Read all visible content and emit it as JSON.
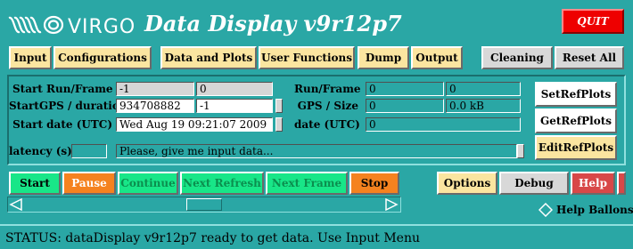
{
  "header": {
    "logo_text": "VIRGO",
    "title": "Data Display  v9r12p7",
    "quit_label": "QUIT"
  },
  "menu": {
    "input": "Input",
    "configurations": "Configurations",
    "data_and_plots": "Data and Plots",
    "user_functions": "User Functions",
    "dump": "Dump",
    "output": "Output",
    "cleaning": "Cleaning",
    "reset_all": "Reset All"
  },
  "panel": {
    "start_run_label": "Start Run/Frame",
    "start_run_value1": "-1",
    "start_run_value2": "0",
    "start_gps_label": "StartGPS / duration",
    "start_gps_value": "934708882",
    "duration_value": "-1",
    "start_date_label": "Start date (UTC)",
    "start_date_value": "Wed Aug 19 09:21:07 2009",
    "run_frame_label": "Run/Frame",
    "run_frame_value1": "0",
    "run_frame_value2": "0",
    "gps_size_label": "GPS  / Size",
    "gps_value": "0",
    "size_value": "0.0 kB",
    "date_label": "date (UTC)",
    "date_value": "0",
    "latency_label": "latency (s)",
    "message": "Please, give me input data..."
  },
  "ref_buttons": {
    "set": "SetRefPlots",
    "get": "GetRefPlots",
    "edit": "EditRefPlots"
  },
  "controls": {
    "start": "Start",
    "pause": "Pause",
    "continue": "Continue",
    "next_refresh": "Next Refresh",
    "next_frame": "Next Frame",
    "stop": "Stop",
    "options": "Options",
    "debug": "Debug",
    "help": "Help",
    "help_balloons": "Help Ballons"
  },
  "status": {
    "text": "STATUS: dataDisplay v9r12p7 ready to get data. Use Input Menu"
  }
}
